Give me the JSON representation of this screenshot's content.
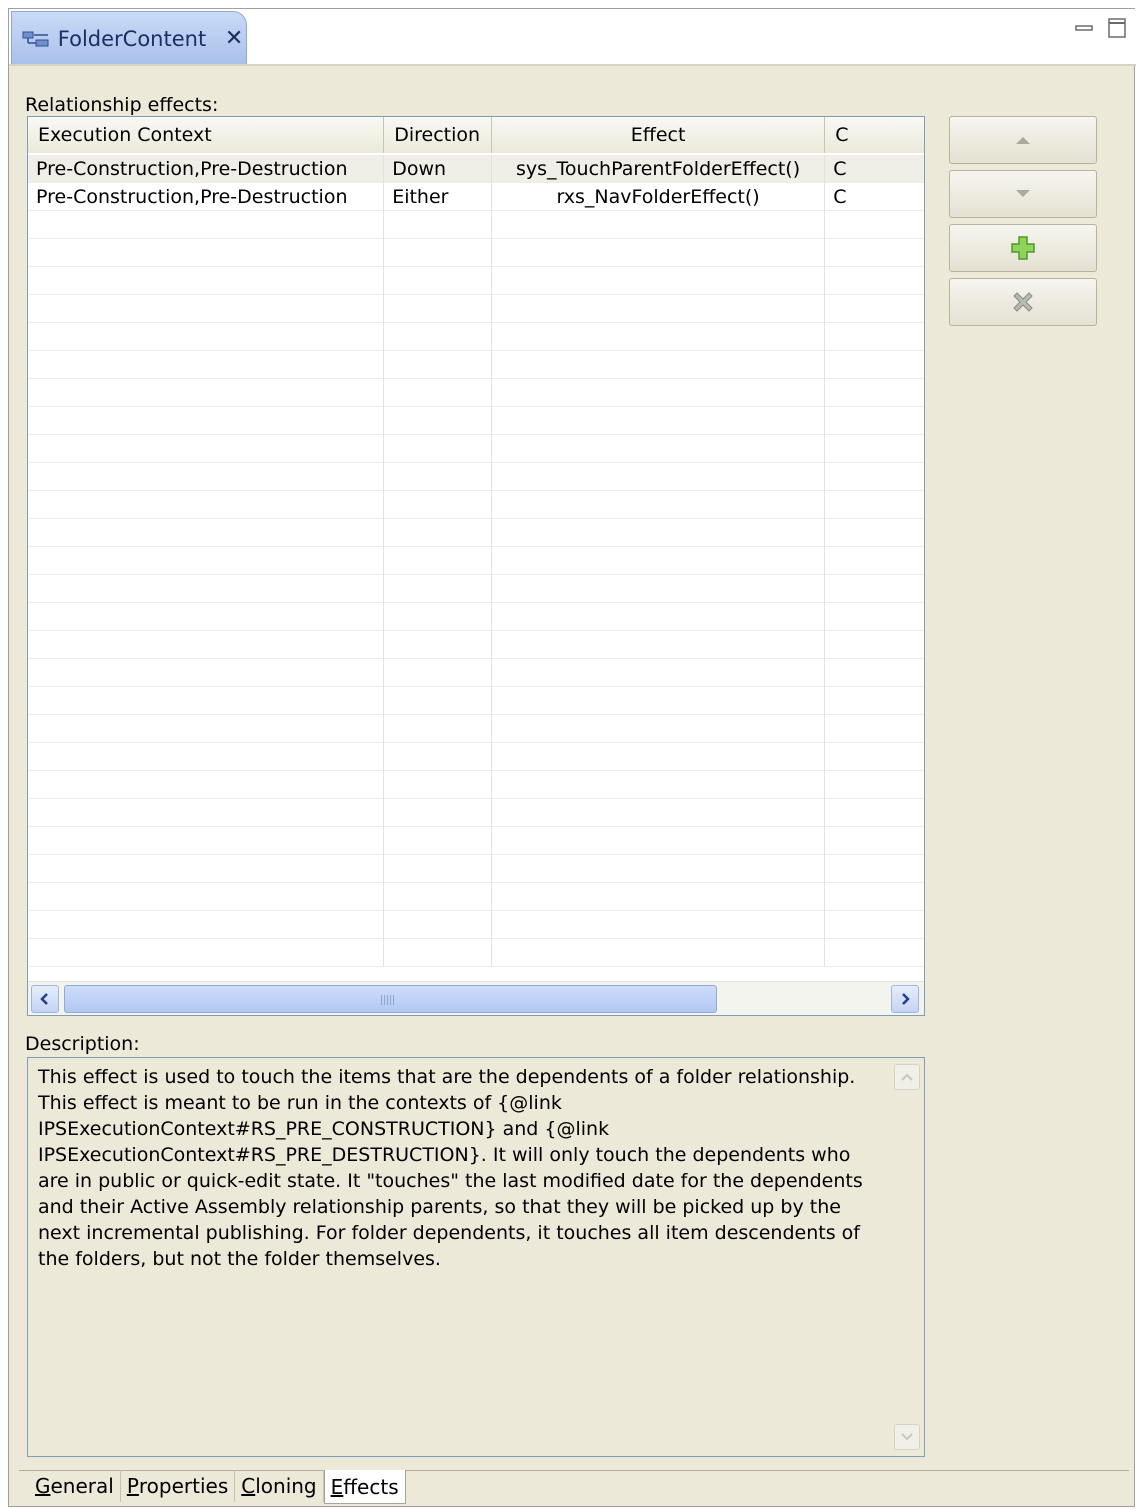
{
  "editor_tab": {
    "title": "FolderContent",
    "icon": "folder-content-icon",
    "close_icon": "close-icon"
  },
  "window_controls": [
    "minimize-icon",
    "maximize-icon"
  ],
  "relationship_section": {
    "label": "Relationship effects:"
  },
  "table": {
    "columns": [
      "Execution Context",
      "Direction",
      "Effect",
      "C"
    ],
    "rows": [
      [
        "Pre-Construction,Pre-Destruction",
        "Down",
        "sys_TouchParentFolderEffect()",
        "C"
      ],
      [
        "Pre-Construction,Pre-Destruction",
        "Either",
        "rxs_NavFolderEffect()",
        "C"
      ]
    ]
  },
  "side_buttons": [
    {
      "name": "move-up-button",
      "icon": "arrow-up-icon"
    },
    {
      "name": "move-down-button",
      "icon": "arrow-down-icon"
    },
    {
      "name": "add-button",
      "icon": "plus-icon"
    },
    {
      "name": "delete-button",
      "icon": "x-icon"
    }
  ],
  "description_section": {
    "label": "Description:",
    "text": "This effect is used to touch the items that are the dependents of a folder relationship.\nThis effect is meant to be run in the contexts of {@link\nIPSExecutionContext#RS_PRE_CONSTRUCTION} and {@link\nIPSExecutionContext#RS_PRE_DESTRUCTION}. It will only touch the dependents who\nare in public or quick-edit state. It \"touches\" the last modified date for the dependents\nand their Active Assembly relationship parents, so that they will be picked up by the\nnext incremental publishing. For folder dependents, it touches all item descendents of\nthe folders, but not the folder themselves."
  },
  "bottom_tabs": [
    {
      "pre": "",
      "key": "G",
      "post": "eneral",
      "active": false
    },
    {
      "pre": "",
      "key": "P",
      "post": "roperties",
      "active": false
    },
    {
      "pre": "",
      "key": "C",
      "post": "loning",
      "active": false
    },
    {
      "pre": "",
      "key": "E",
      "post": "ffects",
      "active": true
    }
  ]
}
